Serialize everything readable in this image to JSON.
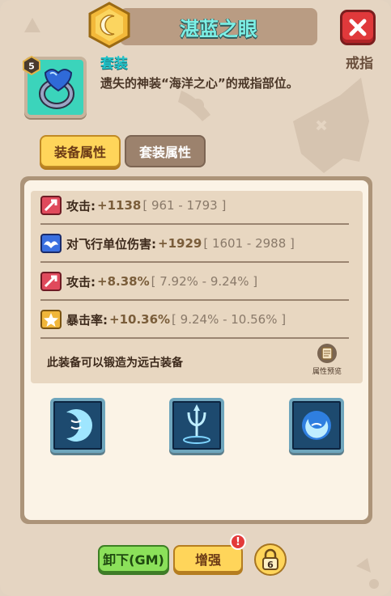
{
  "header": {
    "title": "湛蓝之眼",
    "close_icon": "close-icon"
  },
  "item": {
    "level": "5",
    "set_label": "套装",
    "type": "戒指",
    "description": "遗失的神装“海洋之心”的戒指部位。"
  },
  "tabs": [
    {
      "label": "装备属性",
      "active": true
    },
    {
      "label": "套装属性",
      "active": false
    }
  ],
  "stats": [
    {
      "icon": "attack-icon",
      "name": "攻击:",
      "value": "+1138",
      "range": "[ 961 - 1793 ]"
    },
    {
      "icon": "anti-air-damage-icon",
      "name": "对飞行单位伤害:",
      "value": "+1929",
      "range": "[ 1601 - 2988 ]"
    },
    {
      "icon": "attack-icon",
      "name": "攻击:",
      "value": "+8.38%",
      "range": "[ 7.92% - 9.24% ]"
    },
    {
      "icon": "crit-rate-icon",
      "name": "暴击率:",
      "value": "+10.36%",
      "range": "[ 9.24% - 10.56% ]"
    }
  ],
  "forge_note": "此装备可以锻造为远古装备",
  "preview_label": "属性预览",
  "skills": [
    "wave-crescent-skill-icon",
    "trident-skill-icon",
    "water-orb-skill-icon"
  ],
  "buttons": {
    "unequip": "卸下(GM)",
    "enhance": "增强",
    "alert": "!",
    "lock_level": "6"
  },
  "colors": {
    "title_text": "#7df0e6",
    "set_label": "#22c3c9",
    "tab_active": "#ffd55a",
    "close_red": "#e0393b",
    "green_button": "#8be05a"
  }
}
